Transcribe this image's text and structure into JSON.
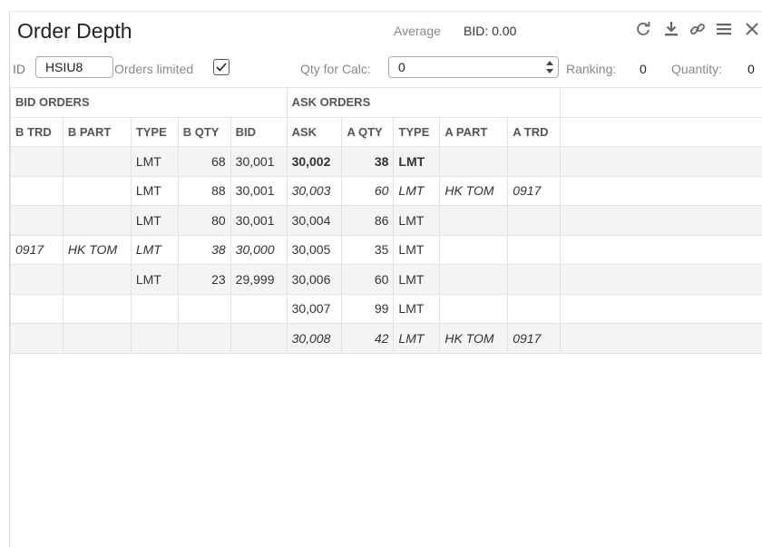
{
  "header": {
    "title": "Order Depth",
    "average_label": "Average",
    "average_value": "BID: 0.00",
    "icons": [
      "refresh-icon",
      "download-icon",
      "link-icon",
      "menu-icon",
      "close-icon"
    ]
  },
  "controls": {
    "id_label": "ID",
    "id_value": "HSIU8",
    "orders_limited_label": "Orders limited",
    "orders_limited_checked": true,
    "qty_label": "Qty for Calc:",
    "qty_value": "0",
    "ranking_label": "Ranking:",
    "ranking_value": "0",
    "quantity_label": "Quantity:",
    "quantity_value": "0"
  },
  "table": {
    "bid_group": "BID ORDERS",
    "ask_group": "ASK ORDERS",
    "columns": [
      "B TRD",
      "B PART",
      "TYPE",
      "B QTY",
      "BID",
      "ASK",
      "A QTY",
      "TYPE",
      "A PART",
      "A TRD"
    ],
    "rows": [
      {
        "cells": [
          "",
          "",
          "LMT",
          "68",
          "30,001",
          "30,002",
          "38",
          "LMT",
          "",
          ""
        ],
        "style": [
          "",
          "",
          "",
          "",
          "",
          "b",
          "b",
          "b",
          "",
          ""
        ]
      },
      {
        "cells": [
          "",
          "",
          "LMT",
          "88",
          "30,001",
          "30,003",
          "60",
          "LMT",
          "HK TOM",
          "0917"
        ],
        "style": [
          "",
          "",
          "",
          "",
          "",
          "i",
          "i",
          "i",
          "i",
          "i"
        ]
      },
      {
        "cells": [
          "",
          "",
          "LMT",
          "80",
          "30,001",
          "30,004",
          "86",
          "LMT",
          "",
          ""
        ],
        "style": [
          "",
          "",
          "",
          "",
          "",
          "",
          "",
          "",
          "",
          ""
        ]
      },
      {
        "cells": [
          "0917",
          "HK TOM",
          "LMT",
          "38",
          "30,000",
          "30,005",
          "35",
          "LMT",
          "",
          ""
        ],
        "style": [
          "i",
          "i",
          "i",
          "i",
          "i",
          "",
          "",
          "",
          "",
          ""
        ]
      },
      {
        "cells": [
          "",
          "",
          "LMT",
          "23",
          "29,999",
          "30,006",
          "60",
          "LMT",
          "",
          ""
        ],
        "style": [
          "",
          "",
          "",
          "",
          "",
          "",
          "",
          "",
          "",
          ""
        ]
      },
      {
        "cells": [
          "",
          "",
          "",
          "",
          "",
          "30,007",
          "99",
          "LMT",
          "",
          ""
        ],
        "style": [
          "",
          "",
          "",
          "",
          "",
          "",
          "",
          "",
          "",
          ""
        ]
      },
      {
        "cells": [
          "",
          "",
          "",
          "",
          "",
          "30,008",
          "42",
          "LMT",
          "HK TOM",
          "0917"
        ],
        "style": [
          "",
          "",
          "",
          "",
          "",
          "i",
          "i",
          "i",
          "i",
          "i"
        ]
      }
    ]
  }
}
